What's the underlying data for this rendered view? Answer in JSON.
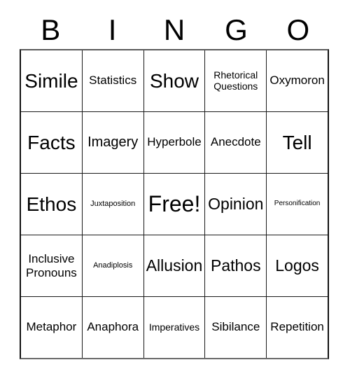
{
  "card": {
    "title_letters": [
      "B",
      "I",
      "N",
      "G",
      "O"
    ],
    "columns": 5,
    "rows": 5,
    "border_color": "#1a1a1a",
    "background_color": "#ffffff",
    "text_color": "#000000",
    "free_space": "Free!"
  },
  "grid": [
    [
      {
        "label": "Simile",
        "size": "lg",
        "lines": 1
      },
      {
        "label": "Statistics",
        "size": "sm",
        "lines": 1
      },
      {
        "label": "Show",
        "size": "lg",
        "lines": 1
      },
      {
        "label": "Rhetorical\nQuestions",
        "size": "xs",
        "lines": 2
      },
      {
        "label": "Oxymoron",
        "size": "sm",
        "lines": 1
      }
    ],
    [
      {
        "label": "Facts",
        "size": "lg",
        "lines": 1
      },
      {
        "label": "Imagery",
        "size": "md",
        "lines": 1
      },
      {
        "label": "Hyperbole",
        "size": "sm",
        "lines": 1
      },
      {
        "label": "Anecdote",
        "size": "sm",
        "lines": 1
      },
      {
        "label": "Tell",
        "size": "lg",
        "lines": 1
      }
    ],
    [
      {
        "label": "Ethos",
        "size": "lg",
        "lines": 1
      },
      {
        "label": "Juxtaposition",
        "size": "xxs",
        "lines": 1
      },
      {
        "label": "Free!",
        "size": "xl",
        "lines": 1
      },
      {
        "label": "Opinion",
        "size": "ml",
        "lines": 1
      },
      {
        "label": "Personification",
        "size": "tiny",
        "lines": 1
      }
    ],
    [
      {
        "label": "Inclusive\nPronouns",
        "size": "sm",
        "lines": 2
      },
      {
        "label": "Anadiplosis",
        "size": "xxs",
        "lines": 1
      },
      {
        "label": "Allusion",
        "size": "ml",
        "lines": 1
      },
      {
        "label": "Pathos",
        "size": "ml",
        "lines": 1
      },
      {
        "label": "Logos",
        "size": "ml",
        "lines": 1
      }
    ],
    [
      {
        "label": "Metaphor",
        "size": "sm",
        "lines": 1
      },
      {
        "label": "Anaphora",
        "size": "sm",
        "lines": 1
      },
      {
        "label": "Imperatives",
        "size": "xs",
        "lines": 1
      },
      {
        "label": "Sibilance",
        "size": "sm",
        "lines": 1
      },
      {
        "label": "Repetition",
        "size": "sm",
        "lines": 1
      }
    ]
  ]
}
